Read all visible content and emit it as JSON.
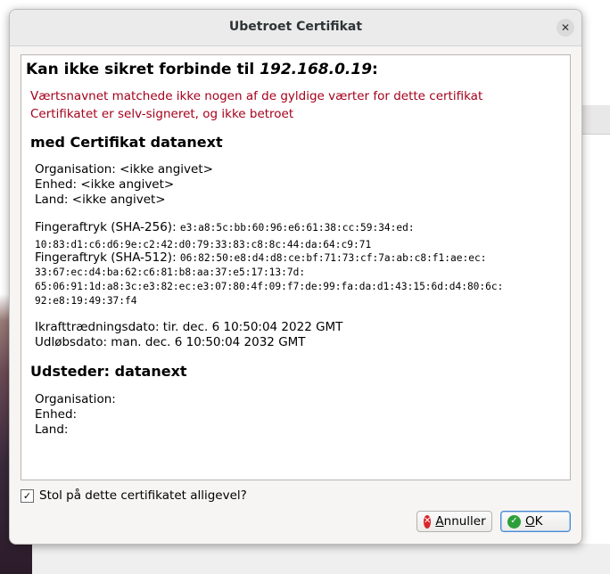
{
  "window": {
    "title": "Ubetroet Certifikat"
  },
  "heading": {
    "prefix": "Kan ikke sikret forbinde til ",
    "host": "192.168.0.19",
    "suffix": ":"
  },
  "errors": [
    "Værtsnavnet matchede ikke nogen af de gyldige værter for dette certifikat",
    "Certifikatet er selv-signeret, og ikke betroet"
  ],
  "certificate": {
    "heading": "med Certifikat datanext",
    "organisation": "Organisation: <ikke angivet>",
    "unit": "Enhed: <ikke angivet>",
    "country": "Land: <ikke angivet>",
    "sha256_label": "Fingeraftryk (SHA-256): ",
    "sha256_lines": [
      "e3:a8:5c:bb:60:96:e6:61:38:cc:59:34:ed:",
      "10:83:d1:c6:d6:9e:c2:42:d0:79:33:83:c8:8c:44:da:64:c9:71"
    ],
    "sha512_label": "Fingeraftryk (SHA-512): ",
    "sha512_lines": [
      "06:82:50:e8:d4:d8:ce:bf:71:73:cf:7a:ab:c8:f1:ae:ec:",
      "33:67:ec:d4:ba:62:c6:81:b8:aa:37:e5:17:13:7d:",
      "65:06:91:1d:a8:3c:e3:82:ec:e3:07:80:4f:09:f7:de:99:fa:da:d1:43:15:6d:d4:80:6c:",
      "92:e8:19:49:37:f4"
    ],
    "valid_from": "Ikrafttrædningsdato: tir. dec. 6 10:50:04 2022 GMT",
    "valid_to": "Udløbsdato: man. dec. 6 10:50:04 2032 GMT"
  },
  "issuer": {
    "heading": "Udsteder: datanext",
    "organisation": "Organisation:",
    "unit": "Enhed:",
    "country": "Land:"
  },
  "trust_checkbox": {
    "label": "Stol på dette certifikatet alligevel?",
    "checked": true,
    "mark": "✓"
  },
  "buttons": {
    "cancel": {
      "pre": "",
      "mnemonic": "A",
      "rest": "nnuller",
      "icon": "cancel-icon"
    },
    "ok": {
      "pre": "",
      "mnemonic": "O",
      "rest": "K",
      "icon": "ok-icon"
    }
  },
  "colors": {
    "error_text": "#a4001b",
    "cancel_icon": "#d9262a",
    "ok_icon": "#2d9f3a"
  }
}
